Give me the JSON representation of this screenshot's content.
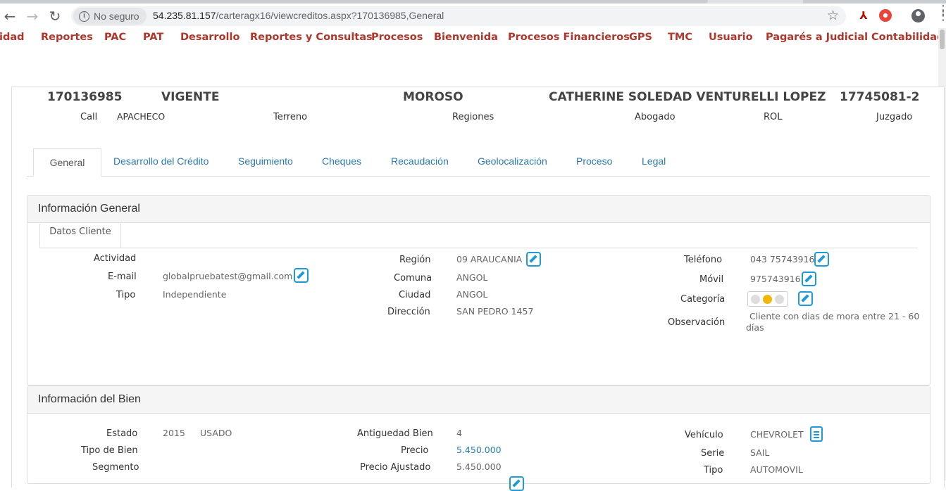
{
  "browser": {
    "security_label": "No seguro",
    "url_host": "54.235.81.157",
    "url_path": "/carteragx16/viewcreditos.aspx?170136985,General"
  },
  "menu": [
    "idad",
    "Reportes",
    "PAC",
    "PAT",
    "Desarrollo",
    "Reportes y Consultas",
    "Procesos",
    "Bienvenida",
    "Procesos Financieros",
    "GPS",
    "TMC",
    "Usuario",
    "Pagarés a Judicial",
    "Contabilidad"
  ],
  "header": {
    "credit_id": "170136985",
    "status": "VIGENTE",
    "delinquency": "MOROSO",
    "client_name": "CATHERINE SOLEDAD VENTURELLI LOPEZ",
    "rut": "17745081-2",
    "call_label": "Call",
    "call_value": "APACHECO",
    "terreno_label": "Terreno",
    "regiones_label": "Regiones",
    "abogado_label": "Abogado",
    "rol_label": "ROL",
    "juzgado_label": "Juzgado"
  },
  "tabs": [
    "General",
    "Desarrollo del Crédito",
    "Seguimiento",
    "Cheques",
    "Recaudación",
    "Geolocalización",
    "Proceso",
    "Legal"
  ],
  "general": {
    "title": "Información General",
    "subtab": "Datos Cliente",
    "actividad_label": "Actividad",
    "email_label": "E-mail",
    "email_value": "globalpruebatest@gmail.com",
    "tipo_label": "Tipo",
    "tipo_value": "Independiente",
    "region_label": "Región",
    "region_value": "09 ARAUCANIA",
    "comuna_label": "Comuna",
    "comuna_value": "ANGOL",
    "ciudad_label": "Ciudad",
    "ciudad_value": "ANGOL",
    "direccion_label": "Dirección",
    "direccion_value": "SAN PEDRO 1457",
    "telefono_label": "Teléfono",
    "telefono_value": "043 75743916",
    "movil_label": "Móvil",
    "movil_value": "975743916",
    "categoria_label": "Categoría",
    "observacion_label": "Observación",
    "observacion_line1": "Cliente con dias de mora entre 21 - 60",
    "observacion_line2": "días"
  },
  "bien": {
    "title": "Información del Bien",
    "estado_label": "Estado",
    "estado_year": "2015",
    "estado_value": "USADO",
    "tipo_bien_label": "Tipo de Bien",
    "segmento_label": "Segmento",
    "antiguedad_label": "Antiguedad Bien",
    "antiguedad_value": "4",
    "precio_label": "Precio",
    "precio_value": "5.450.000",
    "precio_ajustado_label": "Precio Ajustado",
    "precio_ajustado_value": "5.450.000",
    "vehiculo_label": "Vehículo",
    "vehiculo_value": "CHEVROLET",
    "serie_label": "Serie",
    "serie_value": "SAIL",
    "tipo_label": "Tipo",
    "tipo_value": "AUTOMOVIL"
  }
}
